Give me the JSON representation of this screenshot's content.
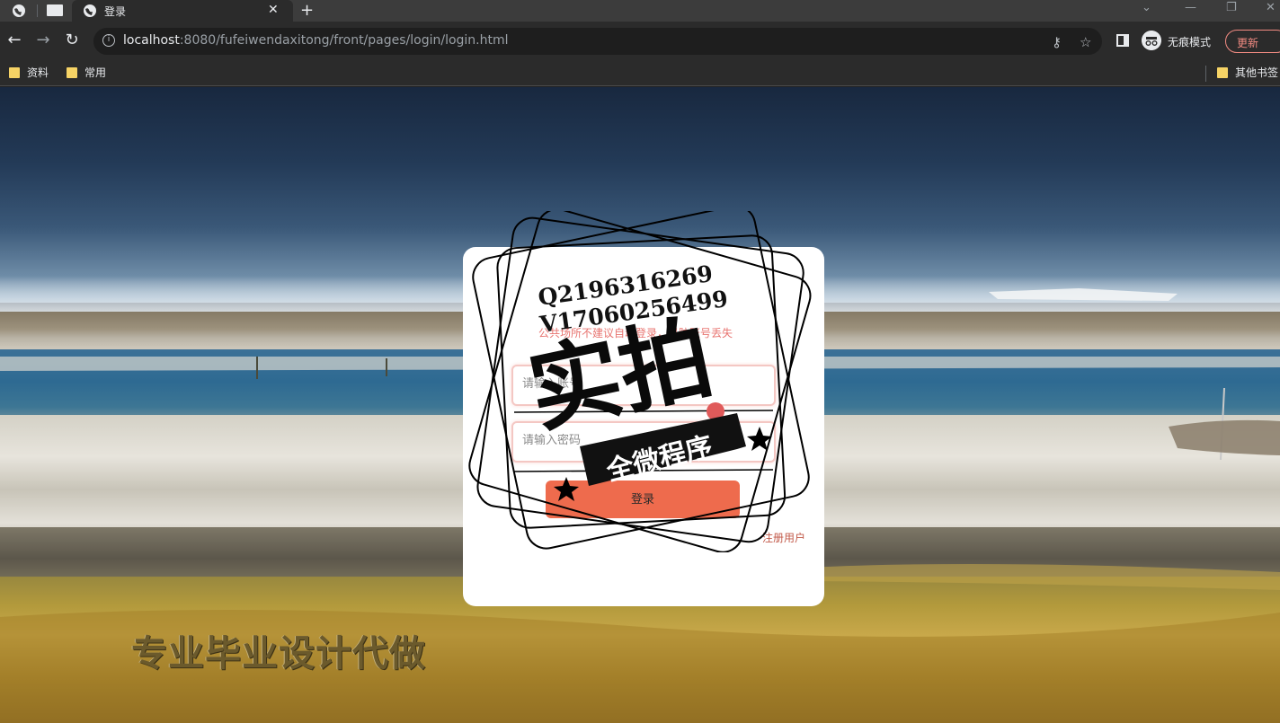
{
  "browser": {
    "tab_title": "登录",
    "url_host": "localhost",
    "url_rest": ":8080/fufeiwendaxitong/front/pages/login/login.html",
    "incognito_label": "无痕模式",
    "update_label": "更新",
    "bookmarks": [
      "资料",
      "常用"
    ],
    "other_bookmarks": "其他书签"
  },
  "login": {
    "tip": "公共场所不建议自动登录，以防账号丢失",
    "username_placeholder": "请输入账号",
    "password_placeholder": "请输入密码",
    "login_label": "登录",
    "register_label": "注册用户"
  },
  "watermark": {
    "contact_line1": "Q2196316269",
    "contact_line2": "V17060256499",
    "big_text": "实拍",
    "ribbon_text": "全微程序",
    "bottom_text": "专业毕业设计代做"
  },
  "colors": {
    "accent": "#ee6b4d",
    "tip": "#e87470",
    "field_border": "#f4c7c3"
  }
}
